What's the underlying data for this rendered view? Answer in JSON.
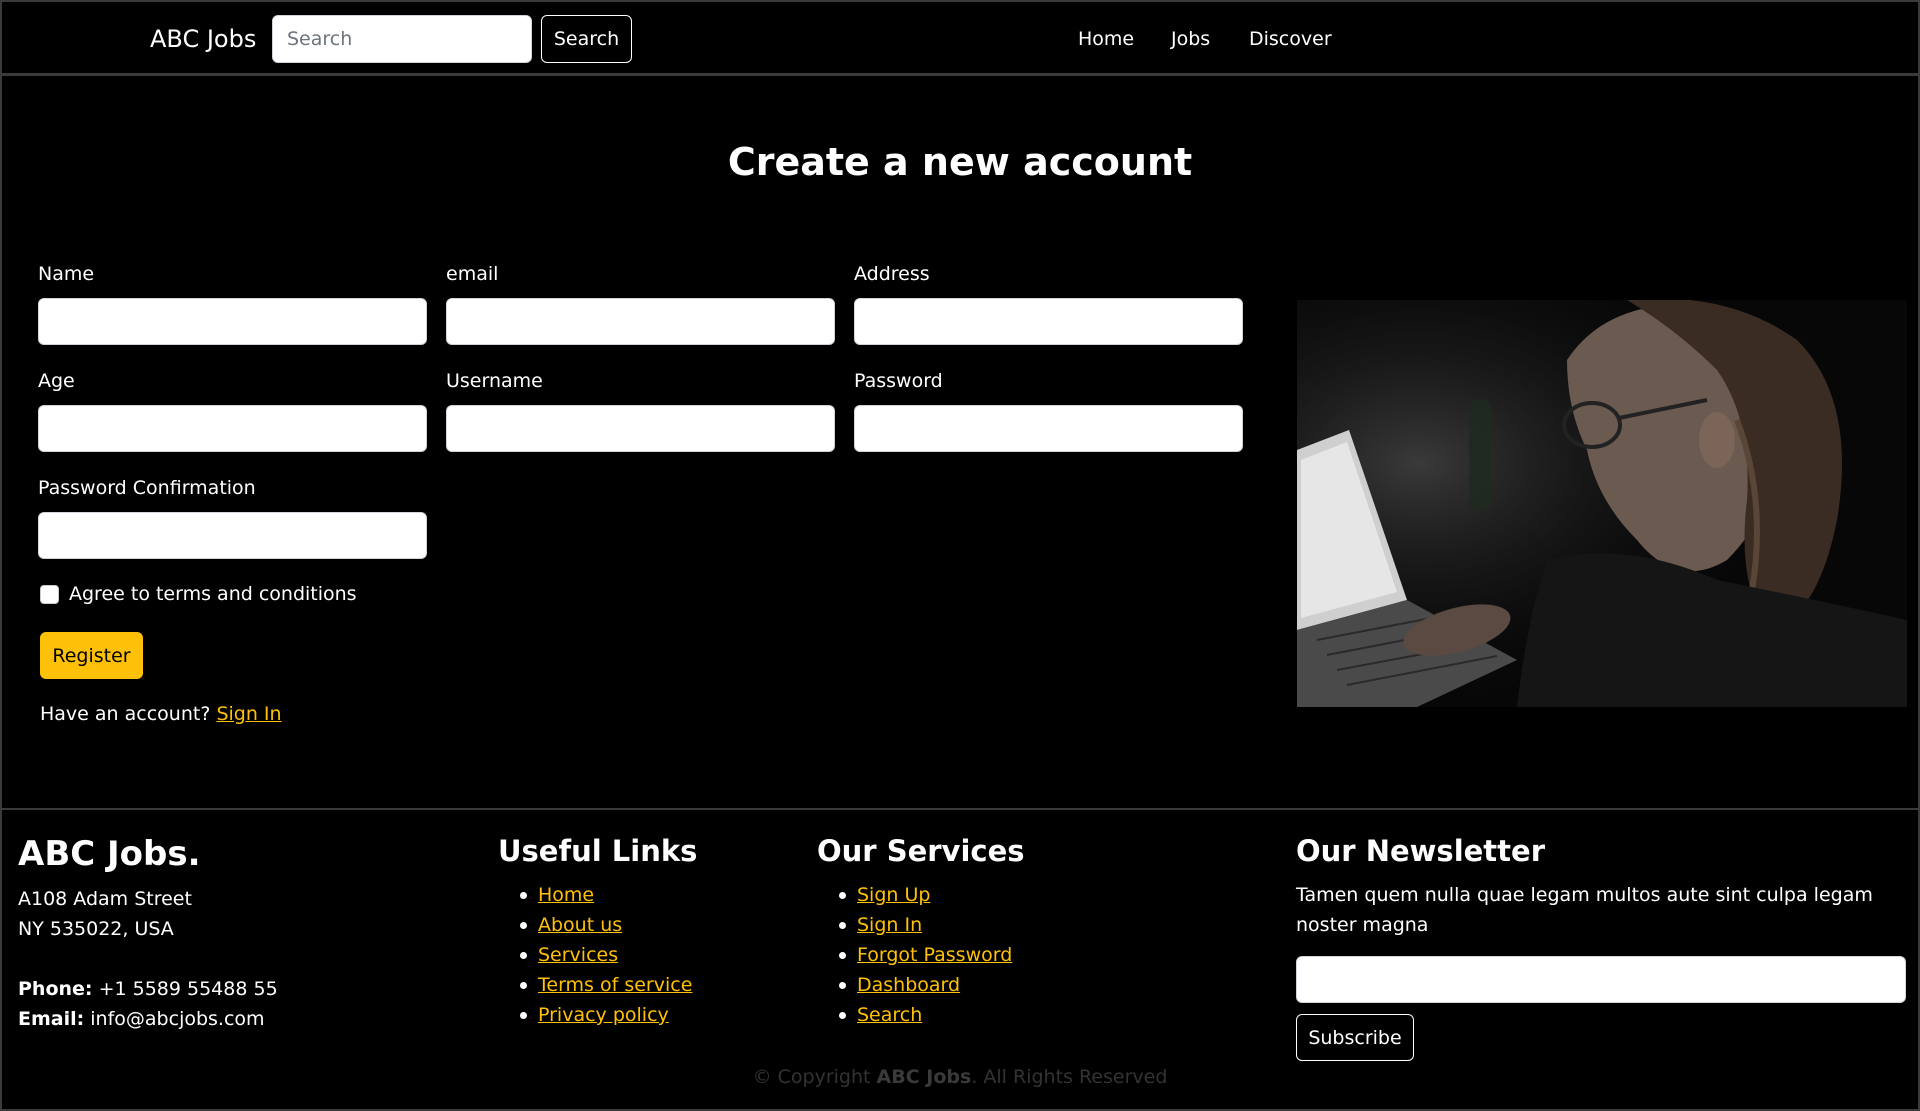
{
  "navbar": {
    "brand": "ABC Jobs",
    "search_placeholder": "Search",
    "search_button": "Search",
    "links": [
      "Home",
      "Jobs",
      "Discover"
    ]
  },
  "main": {
    "title": "Create a new account",
    "fields": {
      "name": "Name",
      "email": "email",
      "address": "Address",
      "age": "Age",
      "username": "Username",
      "password": "Password",
      "password_confirmation": "Password Confirmation"
    },
    "terms_label": "Agree to terms and conditions",
    "register_button": "Register",
    "have_account": "Have an account?",
    "signin_link": "Sign In"
  },
  "footer": {
    "brand": "ABC Jobs.",
    "address_line1": "A108 Adam Street",
    "address_line2": "NY 535022, USA",
    "phone_label": "Phone:",
    "phone": "+1 5589 55488 55",
    "email_label": "Email:",
    "email": "info@abcjobs.com",
    "useful_links_title": "Useful Links",
    "useful_links": [
      "Home",
      "About us",
      "Services",
      "Terms of service",
      "Privacy policy"
    ],
    "services_title": "Our Services",
    "services": [
      "Sign Up",
      "Sign In",
      "Forgot Password",
      "Dashboard",
      "Search"
    ],
    "newsletter_title": "Our Newsletter",
    "newsletter_text": "Tamen quem nulla quae legam multos aute sint culpa legam noster magna",
    "subscribe_button": "Subscribe",
    "copyright_prefix": "© Copyright",
    "copyright_brand": "ABC Jobs",
    "copyright_suffix": ". All Rights Reserved"
  },
  "colors": {
    "accent": "#ffc107",
    "background": "#000000",
    "text": "#ffffff"
  }
}
